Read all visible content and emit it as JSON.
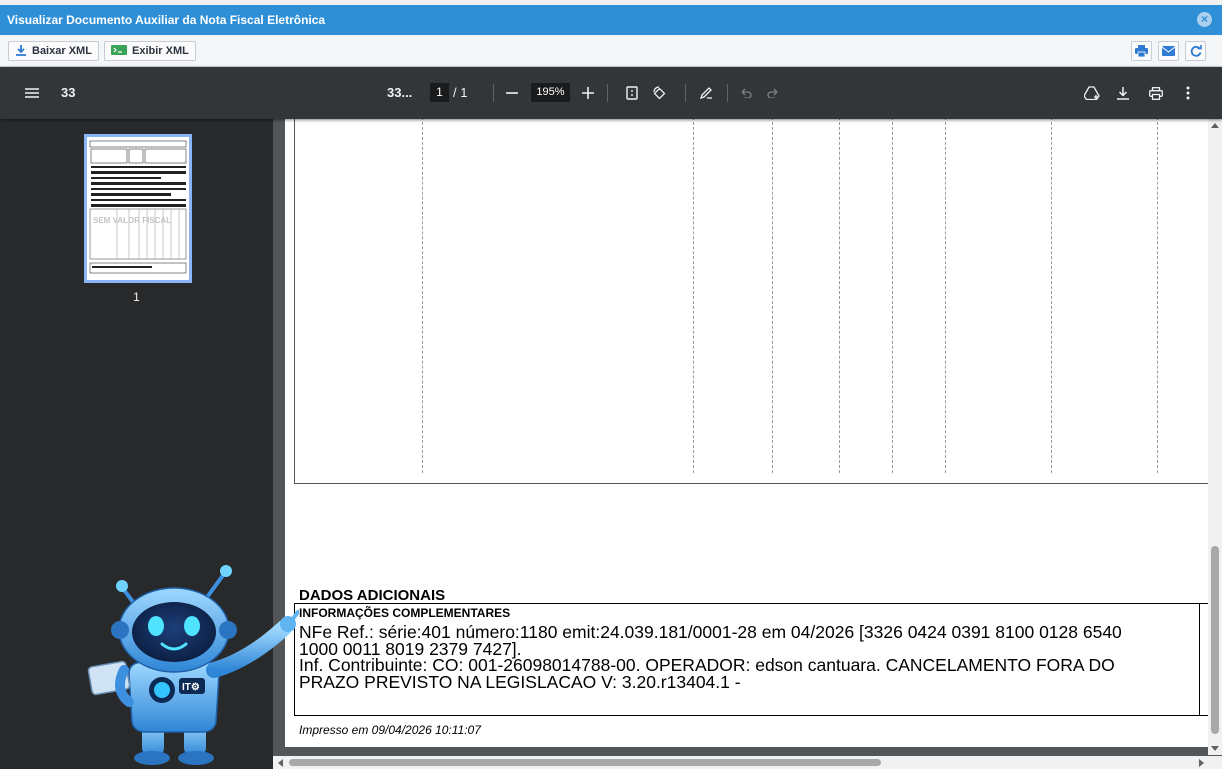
{
  "modal": {
    "title": "Visualizar Documento Auxiliar da Nota Fiscal Eletrônica"
  },
  "toolbar": {
    "download_xml_label": "Baixar XML",
    "view_xml_label": "Exibir XML"
  },
  "pdf_viewer": {
    "doc_title": "33",
    "doc_title_short": "33...",
    "current_page": "1",
    "page_separator": "/ 1",
    "zoom": "195%",
    "thumbnail_page_number": "1",
    "thumbnail_watermark": "SEM VALOR FISCAL"
  },
  "document": {
    "section_title": "DADOS ADICIONAIS",
    "info_label": "INFORMAÇÕES COMPLEMENTARES",
    "info_lines": [
      "NFe Ref.: série:401 número:1180 emit:24.039.181/0001-28 em 04/2026 [3326 0424 0391 8100 0128 6540",
      "1000 0011 8019 2379 7427].",
      "Inf. Contribuinte: CO: 001-26098014788-00. OPERADOR: edson cantuara. CANCELAMENTO FORA DO",
      "PRAZO PREVISTO NA LEGISLACAO V: 3.20.r13404.1 -"
    ],
    "printed_at": "Impresso em 09/04/2026 10:11:07"
  },
  "colors": {
    "titlebar": "#2f8fd6",
    "viewer_bg": "#323639",
    "sidebar_bg": "#27292b",
    "page_gutter": "#525659"
  }
}
